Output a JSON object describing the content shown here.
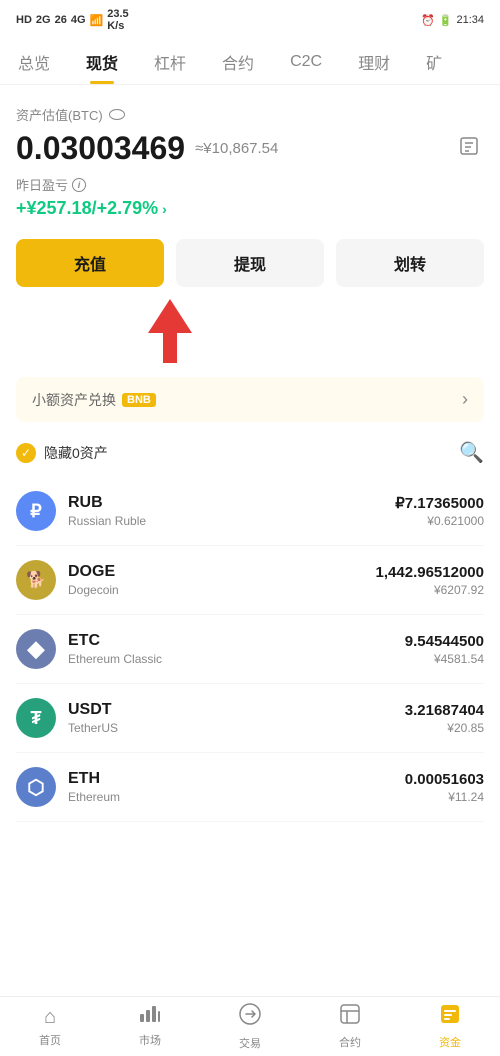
{
  "statusBar": {
    "left": "HD 2G 26 46",
    "wifi": "WiFi",
    "speed": "23.5 K/s",
    "time": "21:34",
    "battery": "20"
  },
  "nav": {
    "tabs": [
      {
        "id": "overview",
        "label": "总览",
        "active": false
      },
      {
        "id": "spot",
        "label": "现货",
        "active": true
      },
      {
        "id": "leverage",
        "label": "杠杆",
        "active": false
      },
      {
        "id": "contract",
        "label": "合约",
        "active": false
      },
      {
        "id": "c2c",
        "label": "C2C",
        "active": false
      },
      {
        "id": "wealth",
        "label": "理财",
        "active": false
      },
      {
        "id": "mining",
        "label": "矿",
        "active": false
      }
    ]
  },
  "portfolio": {
    "assetLabel": "资产估值(BTC)",
    "btcValue": "0.03003469",
    "cnyApprox": "≈¥10,867.54",
    "yesterdayLabel": "昨日盈亏",
    "pnlValue": "+¥257.18/+2.79%",
    "receiveBtn": "充值",
    "withdrawBtn": "提现",
    "transferBtn": "划转"
  },
  "banner": {
    "text": "小额资产兑换",
    "bnbLabel": "BNB"
  },
  "filter": {
    "hideLabel": "隐藏0资产"
  },
  "assets": [
    {
      "id": "rub",
      "symbol": "RUB",
      "name": "Russian Ruble",
      "amount": "₽7.17365000",
      "cny": "¥0.621000",
      "iconText": "₽",
      "iconClass": "rub"
    },
    {
      "id": "doge",
      "symbol": "DOGE",
      "name": "Dogecoin",
      "amount": "1,442.96512000",
      "cny": "¥6207.92",
      "iconText": "D",
      "iconClass": "doge"
    },
    {
      "id": "etc",
      "symbol": "ETC",
      "name": "Ethereum Classic",
      "amount": "9.54544500",
      "cny": "¥4581.54",
      "iconText": "◆",
      "iconClass": "etc"
    },
    {
      "id": "usdt",
      "symbol": "USDT",
      "name": "TetherUS",
      "amount": "3.21687404",
      "cny": "¥20.85",
      "iconText": "₮",
      "iconClass": "usdt"
    },
    {
      "id": "eth",
      "symbol": "ETH",
      "name": "Ethereum",
      "amount": "0.00051603",
      "cny": "¥11.24",
      "iconText": "⬡",
      "iconClass": "eth"
    }
  ],
  "bottomNav": [
    {
      "id": "home",
      "label": "首页",
      "icon": "⌂",
      "active": false
    },
    {
      "id": "market",
      "label": "市场",
      "icon": "▦",
      "active": false
    },
    {
      "id": "trade",
      "label": "交易",
      "icon": "⇄",
      "active": false
    },
    {
      "id": "futures",
      "label": "合约",
      "icon": "⊟",
      "active": false
    },
    {
      "id": "assets",
      "label": "资金",
      "icon": "▣",
      "active": true
    }
  ]
}
